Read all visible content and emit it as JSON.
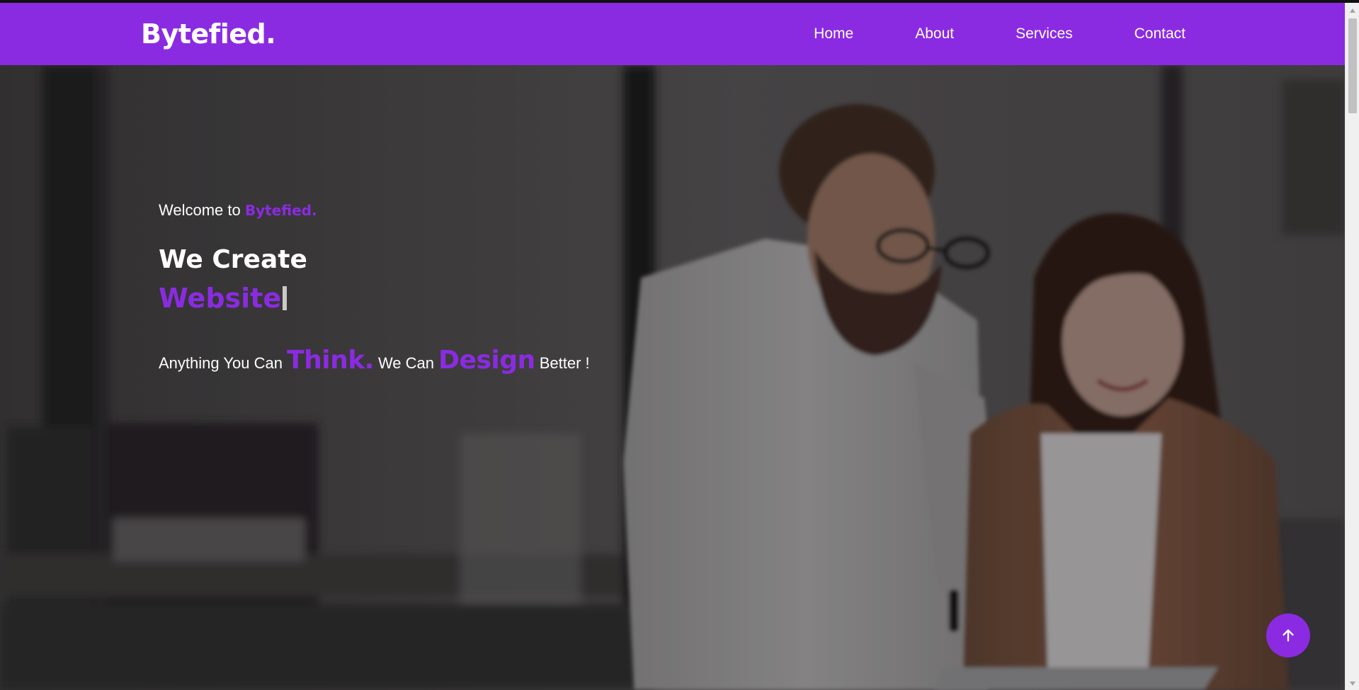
{
  "navbar": {
    "brand": "Bytefied.",
    "links": [
      {
        "label": "Home"
      },
      {
        "label": "About"
      },
      {
        "label": "Services"
      },
      {
        "label": "Contact"
      }
    ]
  },
  "hero": {
    "welcome_prefix": "Welcome to ",
    "welcome_brand": "Bytefied.",
    "headline_line1": "We Create",
    "headline_typed": "Website",
    "tagline": {
      "part1": "Anything You Can ",
      "word1": "Think.",
      "part2": " We Can ",
      "word2": "Design",
      "part3": " Better !"
    }
  },
  "icons": {
    "back_to_top": "arrow-up-icon"
  },
  "colors": {
    "accent": "#8a2be2",
    "text_on_dark": "#ffffff"
  }
}
